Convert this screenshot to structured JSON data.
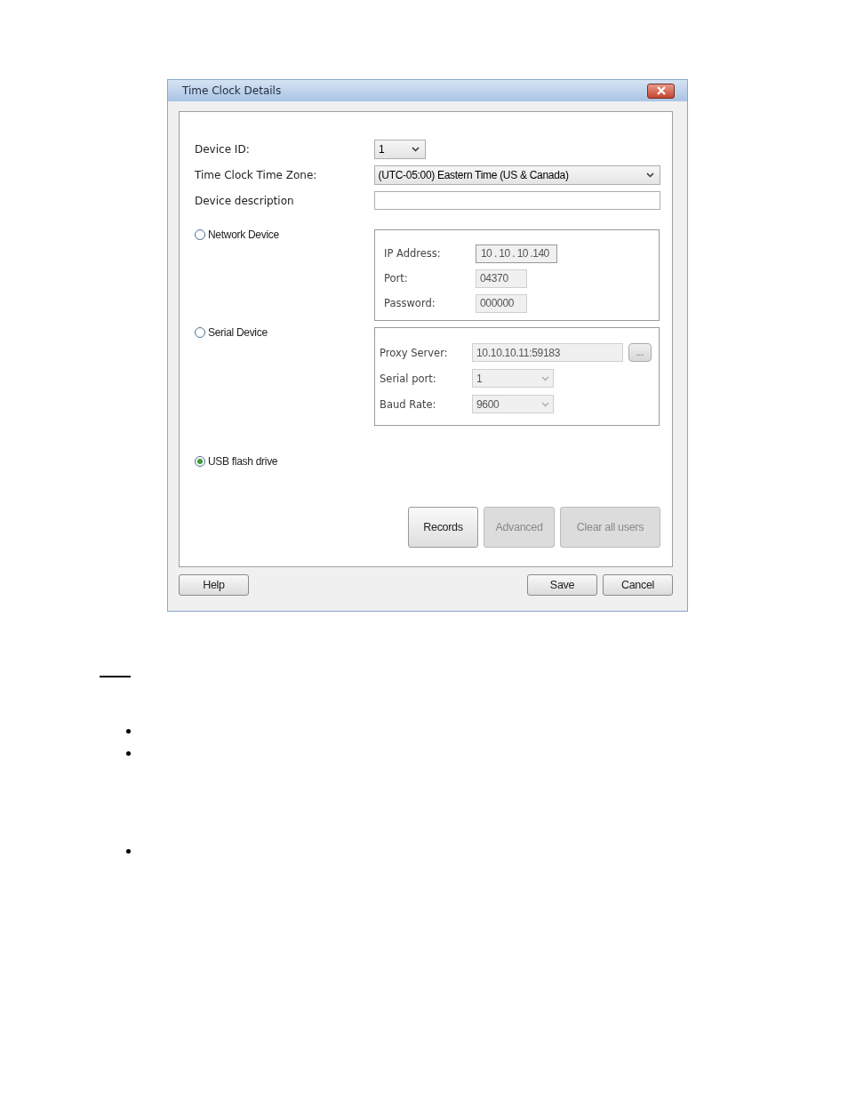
{
  "window": {
    "title": "Time Clock Details"
  },
  "fields": [
    {
      "label": "Device ID:",
      "kind": "dropdown",
      "value": "1"
    },
    {
      "label": "Time Clock Time Zone:",
      "kind": "dropdown",
      "value": "(UTC-05:00) Eastern Time (US & Canada)"
    },
    {
      "label": "Device description",
      "kind": "text"
    }
  ],
  "connections": [
    {
      "label": "Network Device",
      "selected": false,
      "settings": [
        {
          "label": "IP Address:",
          "kind": "ip",
          "value": "10 . 10 . 10 .140"
        },
        {
          "label": "Port:",
          "kind": "text",
          "value": "04370"
        },
        {
          "label": "Password:",
          "kind": "text",
          "value": "000000"
        }
      ]
    },
    {
      "label": "Serial Device",
      "selected": false,
      "settings": [
        {
          "label": "Proxy Server:",
          "kind": "browse",
          "value": "10.10.10.11:59183",
          "button": "..."
        },
        {
          "label": "Serial port:",
          "kind": "dropdown",
          "value": "1"
        },
        {
          "label": "Baud Rate:",
          "kind": "dropdown",
          "value": "9600"
        }
      ]
    },
    {
      "label": "USB flash drive",
      "selected": true
    }
  ],
  "actions": [
    {
      "label": "Records",
      "disabled": false
    },
    {
      "label": "Advanced",
      "disabled": true
    },
    {
      "label": "Clear all users",
      "disabled": true
    }
  ],
  "footer": {
    "left": [
      {
        "label": "Help"
      }
    ],
    "right": [
      {
        "label": "Save"
      },
      {
        "label": "Cancel"
      }
    ]
  }
}
